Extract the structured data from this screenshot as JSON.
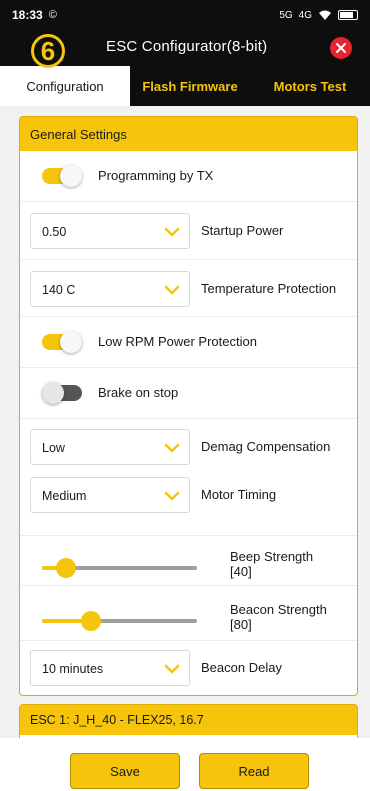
{
  "status_bar": {
    "time": "18:33",
    "alarm_icon": "©",
    "network_1": "5G",
    "network_2": "4G"
  },
  "header": {
    "badge": "6",
    "title": "ESC Configurator(8-bit)"
  },
  "tabs": [
    {
      "label": "Configuration",
      "active": true
    },
    {
      "label": "Flash Firmware",
      "active": false
    },
    {
      "label": "Motors Test",
      "active": false
    }
  ],
  "general": {
    "title": "General Settings",
    "programming_by_tx": {
      "label": "Programming by TX",
      "on": true
    },
    "startup_power": {
      "value": "0.50",
      "label": "Startup Power"
    },
    "temperature_protection": {
      "value": "140 C",
      "label": "Temperature Protection"
    },
    "low_rpm_power_protection": {
      "label": "Low RPM Power Protection",
      "on": true
    },
    "brake_on_stop": {
      "label": "Brake on stop",
      "on": false
    },
    "demag_compensation": {
      "value": "Low",
      "label": "Demag Compensation"
    },
    "motor_timing": {
      "value": "Medium",
      "label": "Motor Timing"
    },
    "beep_strength": {
      "label": "Beep Strength",
      "value_text": "[40]",
      "value": 40,
      "max": 255
    },
    "beacon_strength": {
      "label": "Beacon Strength",
      "value_text": "[80]",
      "value": 80,
      "max": 255
    },
    "beacon_delay": {
      "value": "10 minutes",
      "label": "Beacon Delay"
    }
  },
  "esc1": {
    "title": "ESC 1: J_H_40 - FLEX25, 16.7"
  },
  "buttons": {
    "save": "Save",
    "read": "Read"
  },
  "colors": {
    "accent": "#f5c40b",
    "dark": "#0e0e0e",
    "danger": "#e3262f"
  }
}
